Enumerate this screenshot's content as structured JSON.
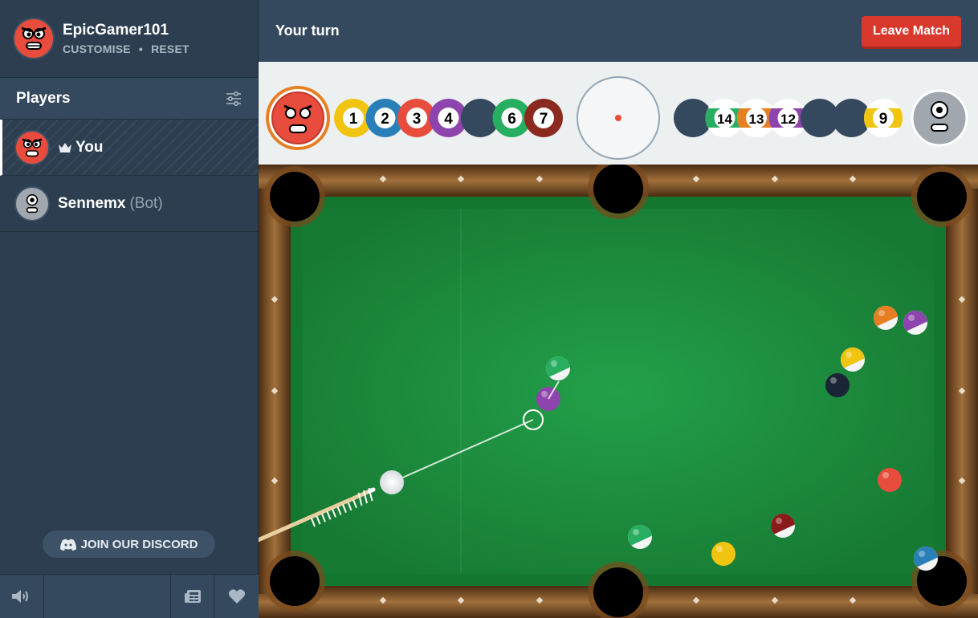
{
  "profile": {
    "username": "EpicGamer101",
    "customise": "CUSTOMISE",
    "separator": "•",
    "reset": "RESET"
  },
  "players": {
    "title": "Players",
    "list": [
      {
        "name": "You",
        "crown": true
      },
      {
        "name": "Sennemx",
        "tag": "(Bot)"
      }
    ]
  },
  "discord": {
    "label": "JOIN OUR DISCORD"
  },
  "header": {
    "status": "Your turn",
    "leave": "Leave Match"
  },
  "hud": {
    "left_balls": [
      {
        "n": "1",
        "c": "#f1c40f",
        "s": false
      },
      {
        "n": "2",
        "c": "#2980b9",
        "s": false
      },
      {
        "n": "3",
        "c": "#e74c3c",
        "s": false
      },
      {
        "n": "4",
        "c": "#8e44ad",
        "s": false
      },
      {
        "n": "",
        "c": "#34495e",
        "s": false
      },
      {
        "n": "6",
        "c": "#27ae60",
        "s": false
      },
      {
        "n": "7",
        "c": "#8b2a1f",
        "s": false
      }
    ],
    "right_balls": [
      {
        "n": "",
        "c": "#34495e",
        "s": false
      },
      {
        "n": "14",
        "c": "#27ae60",
        "s": true
      },
      {
        "n": "13",
        "c": "#e67e22",
        "s": true
      },
      {
        "n": "12",
        "c": "#8e44ad",
        "s": true
      },
      {
        "n": "",
        "c": "#34495e",
        "s": false
      },
      {
        "n": "",
        "c": "#34495e",
        "s": false
      },
      {
        "n": "9",
        "c": "#f1c40f",
        "s": true
      }
    ],
    "active_player_color": "#e67e22"
  },
  "colors": {
    "felt": "#1c8c3c",
    "rail": "#6b4423",
    "accent": "#d9382c"
  }
}
